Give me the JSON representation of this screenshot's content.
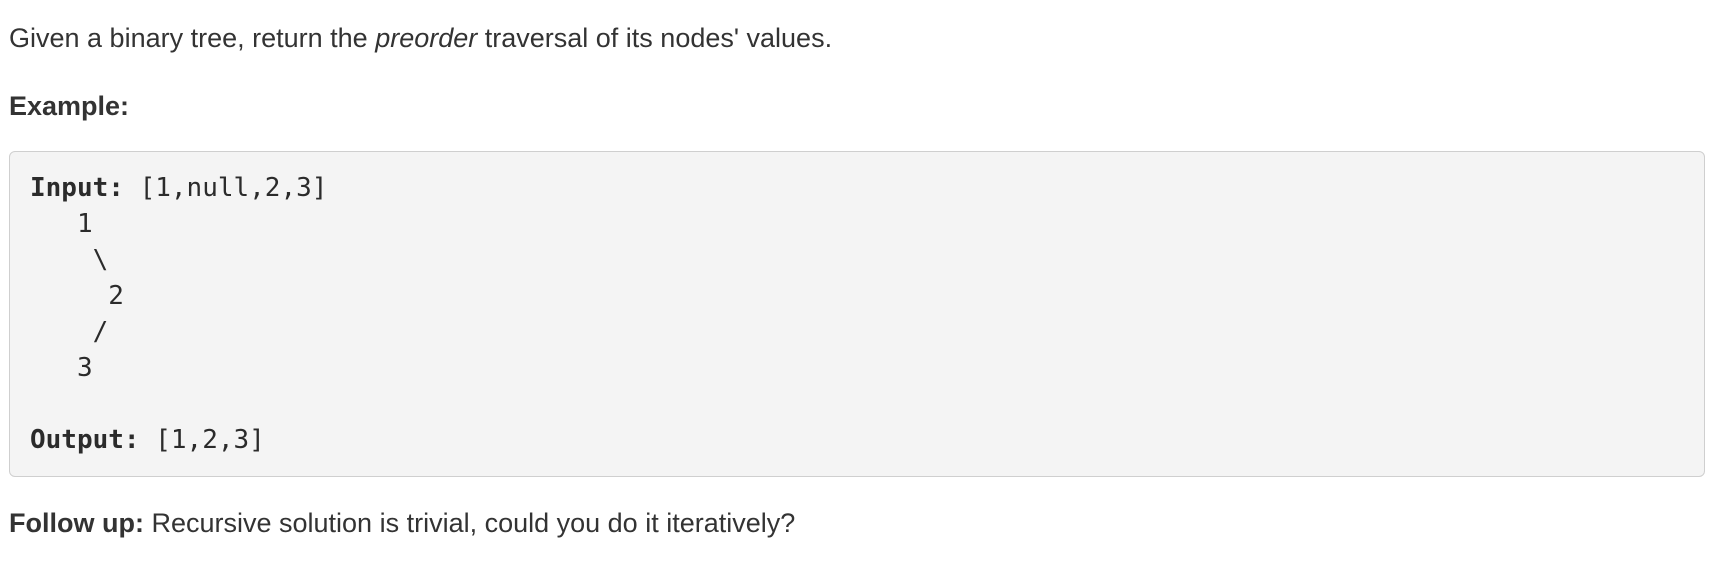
{
  "description": {
    "prefix": "Given a binary tree, return the ",
    "emphasis": "preorder",
    "suffix": " traversal of its nodes' values."
  },
  "example": {
    "heading": "Example:",
    "input_label": "Input:",
    "input_value": " [1,null,2,3]",
    "tree_lines": [
      "   1",
      "    \\",
      "     2",
      "    /",
      "   3"
    ],
    "output_label": "Output:",
    "output_value": " [1,2,3]"
  },
  "follow_up": {
    "label": "Follow up:",
    "text": " Recursive solution is trivial, could you do it iteratively?"
  }
}
